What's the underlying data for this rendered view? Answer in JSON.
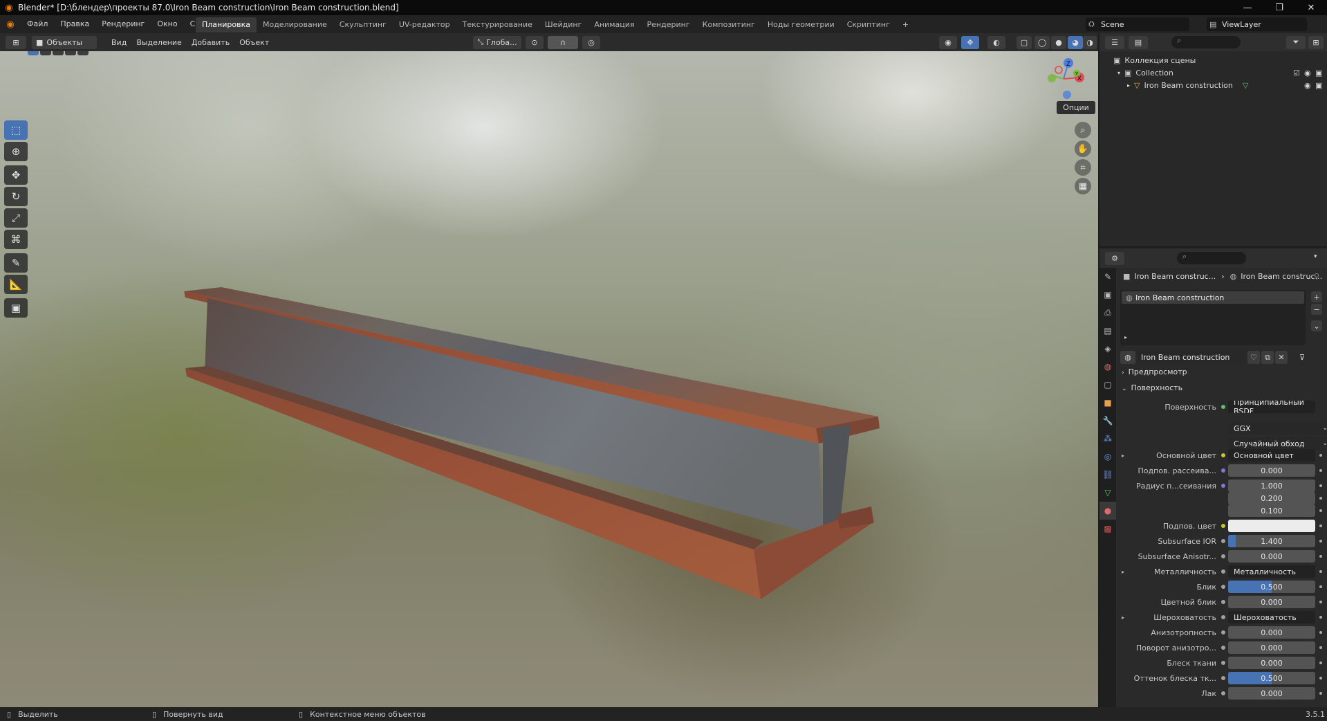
{
  "title_bar": {
    "title": "Blender* [D:\\блендер\\проекты 87.0\\Iron Beam construction\\Iron Beam construction.blend]",
    "minimize": "—",
    "maximize": "❐",
    "close": "✕"
  },
  "menu": {
    "items": [
      "Файл",
      "Правка",
      "Рендеринг",
      "Окно",
      "Справка"
    ]
  },
  "workspace_tabs": [
    "Планировка",
    "Моделирование",
    "Скульптинг",
    "UV-редактор",
    "Текстурирование",
    "Шейдинг",
    "Анимация",
    "Рендеринг",
    "Композитинг",
    "Ноды геометрии",
    "Скриптинг"
  ],
  "active_workspace_index": 0,
  "add_workspace": "+",
  "scene": {
    "name": "Scene",
    "view_layer": "ViewLayer"
  },
  "viewport_header": {
    "mode": "Объекты",
    "menus": [
      "Вид",
      "Выделение",
      "Добавить",
      "Объект"
    ],
    "transform_orientation": "Глоба...",
    "options_label": "Опции"
  },
  "gizmo": {
    "z": "Z",
    "y": "Y",
    "x": "X"
  },
  "outliner": {
    "root": "Коллекция сцены",
    "collection": "Collection",
    "object": "Iron Beam construction"
  },
  "properties": {
    "breadcrumb_object": "Iron Beam construc...",
    "breadcrumb_material": "Iron Beam construc...",
    "slot_name": "Iron Beam construction",
    "material_name": "Iron Beam construction",
    "panel_preview": "Предпросмотр",
    "panel_surface": "Поверхность",
    "surface_label": "Поверхность",
    "surface_shader": "Принципиальный BSDF",
    "distribution": "GGX",
    "subsurface_method": "Случайный обход",
    "rows": [
      {
        "label": "Основной цвет",
        "value": "Основной цвет",
        "type": "link",
        "dot": "#c7c729",
        "expand": "▸"
      },
      {
        "label": "Подпов. рассеива...",
        "value": "0.000",
        "type": "num",
        "dot": "#7b7bd6",
        "fill": 0
      },
      {
        "label": "Радиус п...сеивания",
        "value": "1.000",
        "type": "num",
        "dot": "#7b7bd6",
        "fill": 0
      },
      {
        "label": "",
        "value": "0.200",
        "type": "num",
        "dot": "",
        "fill": 0
      },
      {
        "label": "",
        "value": "0.100",
        "type": "num",
        "dot": "",
        "fill": 0
      },
      {
        "label": "Подпов. цвет",
        "value": "",
        "type": "color",
        "dot": "#c7c729",
        "color": "#ececec"
      },
      {
        "label": "Subsurface IOR",
        "value": "1.400",
        "type": "num",
        "dot": "#a1a1a1",
        "fill": 0.09
      },
      {
        "label": "Subsurface Anisotr...",
        "value": "0.000",
        "type": "num",
        "dot": "#a1a1a1",
        "fill": 0
      },
      {
        "label": "Металличность",
        "value": "Металличность",
        "type": "link",
        "dot": "#a1a1a1",
        "expand": "▸"
      },
      {
        "label": "Блик",
        "value": "0.500",
        "type": "num",
        "dot": "#a1a1a1",
        "fill": 0.5
      },
      {
        "label": "Цветной блик",
        "value": "0.000",
        "type": "num",
        "dot": "#a1a1a1",
        "fill": 0
      },
      {
        "label": "Шероховатость",
        "value": "Шероховатость",
        "type": "link",
        "dot": "#a1a1a1",
        "expand": "▸"
      },
      {
        "label": "Анизотропность",
        "value": "0.000",
        "type": "num",
        "dot": "#a1a1a1",
        "fill": 0
      },
      {
        "label": "Поворот анизотро...",
        "value": "0.000",
        "type": "num",
        "dot": "#a1a1a1",
        "fill": 0
      },
      {
        "label": "Блеск ткани",
        "value": "0.000",
        "type": "num",
        "dot": "#a1a1a1",
        "fill": 0
      },
      {
        "label": "Оттенок блеска тк...",
        "value": "0.500",
        "type": "num",
        "dot": "#a1a1a1",
        "fill": 0.5
      },
      {
        "label": "Лак",
        "value": "0.000",
        "type": "num",
        "dot": "#a1a1a1",
        "fill": 0
      }
    ]
  },
  "status_bar": {
    "select": "Выделить",
    "rotate": "Повернуть вид",
    "context": "Контекстное меню объектов",
    "version": "3.5.1"
  },
  "colors": {
    "accent": "#4772b3",
    "logo": "#e87d0d"
  }
}
